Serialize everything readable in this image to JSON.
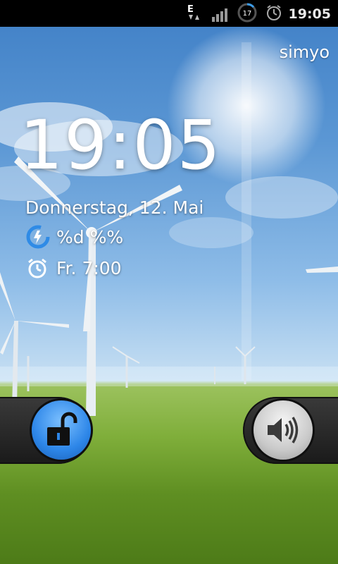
{
  "status_bar": {
    "network_type": "E",
    "battery_level": "17",
    "time": "19:05",
    "icons": [
      "data-transfer-icon",
      "signal-strength-icon",
      "battery-icon",
      "alarm-icon"
    ]
  },
  "carrier": "simyo",
  "clock": "19:05",
  "date": "Donnerstag, 12. Mai",
  "charging": {
    "text": "%d %%",
    "icon": "charging-icon"
  },
  "alarm": {
    "text": "Fr. 7:00",
    "icon": "alarm-icon"
  },
  "controls": {
    "unlock_icon": "unlock-icon",
    "sound_icon": "sound-icon"
  },
  "colors": {
    "unlock_knob": "#2d86e8",
    "status_bar": "#000000"
  }
}
